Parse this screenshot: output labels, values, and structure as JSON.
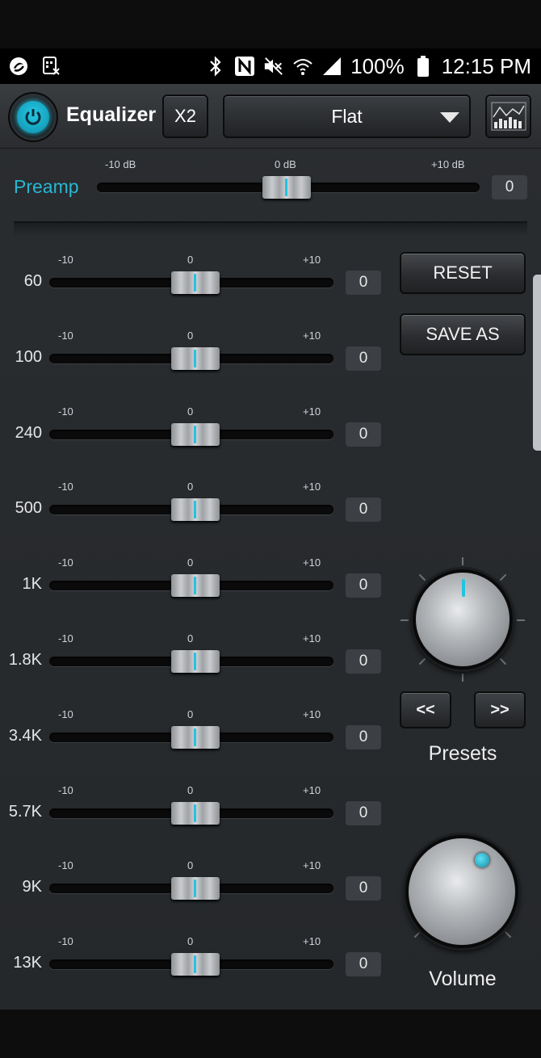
{
  "status_bar": {
    "battery": "100%",
    "time": "12:15 PM",
    "icons": [
      "app-notification-icon",
      "sim-icon",
      "bluetooth-icon",
      "nfc-icon",
      "mute-icon",
      "wifi-icon",
      "signal-icon",
      "battery-icon"
    ]
  },
  "header": {
    "title": "Equalizer",
    "x2_label": "X2",
    "preset_selected": "Flat"
  },
  "preamp": {
    "label": "Preamp",
    "min_label": "-10 dB",
    "mid_label": "0 dB",
    "max_label": "+10 dB",
    "value": "0",
    "level": 0
  },
  "bands": [
    {
      "freq": "60",
      "min": "-10",
      "mid": "0",
      "max": "+10",
      "value": "0",
      "level": 0
    },
    {
      "freq": "100",
      "min": "-10",
      "mid": "0",
      "max": "+10",
      "value": "0",
      "level": 0
    },
    {
      "freq": "240",
      "min": "-10",
      "mid": "0",
      "max": "+10",
      "value": "0",
      "level": 0
    },
    {
      "freq": "500",
      "min": "-10",
      "mid": "0",
      "max": "+10",
      "value": "0",
      "level": 0
    },
    {
      "freq": "1K",
      "min": "-10",
      "mid": "0",
      "max": "+10",
      "value": "0",
      "level": 0
    },
    {
      "freq": "1.8K",
      "min": "-10",
      "mid": "0",
      "max": "+10",
      "value": "0",
      "level": 0
    },
    {
      "freq": "3.4K",
      "min": "-10",
      "mid": "0",
      "max": "+10",
      "value": "0",
      "level": 0
    },
    {
      "freq": "5.7K",
      "min": "-10",
      "mid": "0",
      "max": "+10",
      "value": "0",
      "level": 0
    },
    {
      "freq": "9K",
      "min": "-10",
      "mid": "0",
      "max": "+10",
      "value": "0",
      "level": 0
    },
    {
      "freq": "13K",
      "min": "-10",
      "mid": "0",
      "max": "+10",
      "value": "0",
      "level": 0
    }
  ],
  "actions": {
    "reset_label": "RESET",
    "save_as_label": "SAVE AS"
  },
  "presets": {
    "label": "Presets",
    "prev_label": "<<",
    "next_label": ">>"
  },
  "volume": {
    "label": "Volume"
  },
  "colors": {
    "accent": "#23c3e0",
    "background": "#282b2e"
  }
}
